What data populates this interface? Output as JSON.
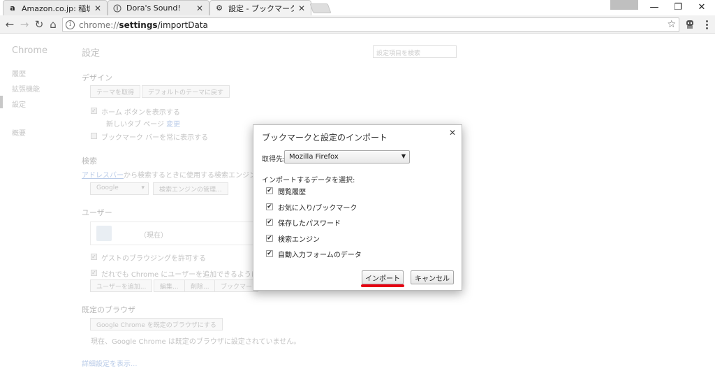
{
  "tabs": [
    {
      "title": "Amazon.co.jp: 稲城浩",
      "favicon": "amazon-icon"
    },
    {
      "title": "Dora's Sound!",
      "favicon": "site-info-icon"
    },
    {
      "title": "設定 - ブックマークと設定のイ",
      "favicon": "gear-icon"
    }
  ],
  "window_controls": {
    "minimize": "—",
    "restore": "❐",
    "close": "✕"
  },
  "address": {
    "scheme": "chrome://",
    "host": "settings",
    "path": "/importData"
  },
  "settings": {
    "sidebar_title": "Chrome",
    "sidebar_items": [
      "履歴",
      "拡張機能",
      "設定",
      "概要"
    ],
    "page_title": "設定",
    "search_placeholder": "設定項目を検索",
    "design": {
      "heading": "デザイン",
      "get_themes": "テーマを取得",
      "reset_theme": "デフォルトのテーマに戻す",
      "show_home": "ホーム ボタンを表示する",
      "new_tab_page": "新しいタブ ページ",
      "change": "変更",
      "show_bookmarks_bar": "ブックマーク バーを常に表示する"
    },
    "search": {
      "heading": "検索",
      "address_bar_link": "アドレスバー",
      "desc": "から検索するときに使用する検索エンジンを",
      "engine": "Google",
      "manage_engines": "検索エンジンの管理..."
    },
    "users": {
      "heading": "ユーザー",
      "current": "（現在）",
      "allow_guest": "ゲストのブラウジングを許可する",
      "allow_add": "だれでも Chrome にユーザーを追加できるようにする",
      "add_user": "ユーザーを追加...",
      "edit": "編集...",
      "delete": "削除...",
      "import_bookmarks": "ブックマー"
    },
    "default_browser": {
      "heading": "既定のブラウザ",
      "make_default": "Google Chrome を既定のブラウザにする",
      "status": "現在、Google Chrome は既定のブラウザに設定されていません。"
    },
    "show_advanced": "詳細設定を表示..."
  },
  "dialog": {
    "title": "ブックマークと設定のインポート",
    "from_label": "取得先:",
    "from_value": "Mozilla Firefox",
    "choose_label": "インポートするデータを選択:",
    "options": [
      {
        "label": "閲覧履歴",
        "checked": true
      },
      {
        "label": "お気に入り/ブックマーク",
        "checked": true
      },
      {
        "label": "保存したパスワード",
        "checked": true
      },
      {
        "label": "検索エンジン",
        "checked": true
      },
      {
        "label": "自動入力フォームのデータ",
        "checked": true
      }
    ],
    "import_button": "インポート",
    "cancel_button": "キャンセル",
    "highlight_color": "#e60012"
  }
}
